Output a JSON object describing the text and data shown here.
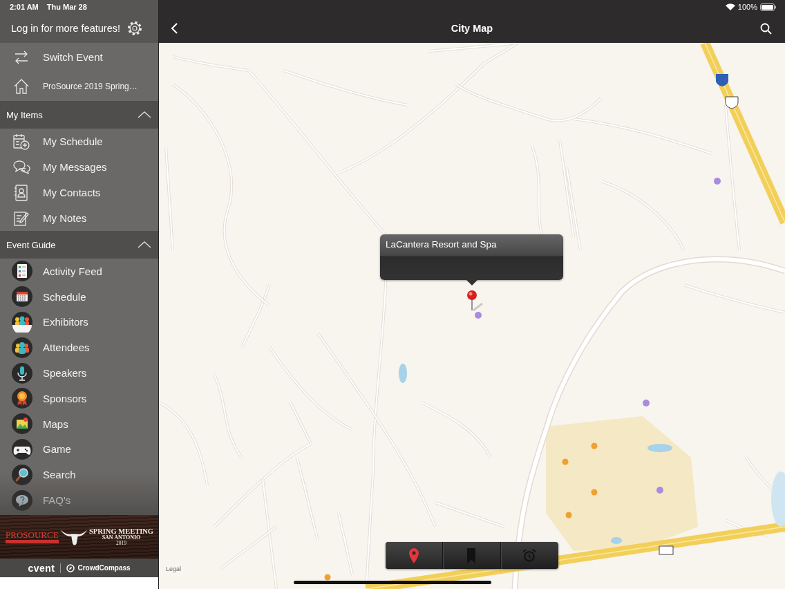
{
  "status_bar": {
    "time": "2:01 AM",
    "date": "Thu Mar 28",
    "battery": "100%"
  },
  "sidebar": {
    "login_prompt": "Log in for more features!",
    "top_items": [
      {
        "kind": "switch",
        "label": "Switch Event"
      },
      {
        "kind": "home",
        "label": "ProSource 2019 Spring…"
      }
    ],
    "sections": [
      {
        "title": "My Items",
        "expanded": true,
        "items": [
          {
            "kind": "schedule",
            "label": "My Schedule"
          },
          {
            "kind": "messages",
            "label": "My Messages"
          },
          {
            "kind": "contacts",
            "label": "My Contacts"
          },
          {
            "kind": "notes",
            "label": "My Notes"
          }
        ]
      },
      {
        "title": "Event Guide",
        "expanded": true,
        "items": [
          {
            "kind": "feed",
            "label": "Activity Feed"
          },
          {
            "kind": "calendar",
            "label": "Schedule"
          },
          {
            "kind": "exhibitors",
            "label": "Exhibitors"
          },
          {
            "kind": "attendees",
            "label": "Attendees"
          },
          {
            "kind": "speakers",
            "label": "Speakers"
          },
          {
            "kind": "sponsors",
            "label": "Sponsors"
          },
          {
            "kind": "maps",
            "label": "Maps"
          },
          {
            "kind": "game",
            "label": "Game"
          },
          {
            "kind": "search",
            "label": "Search"
          },
          {
            "kind": "faq",
            "label": "FAQ's"
          }
        ]
      }
    ],
    "banner": {
      "brand": "PROSOURCE",
      "event": "SPRING MEETING",
      "city": "SAN ANTONIO",
      "year": "2019"
    },
    "footer": {
      "vendor": "cvent",
      "product": "CrowdCompass"
    }
  },
  "nav_bar": {
    "title": "City Map"
  },
  "map": {
    "callout": {
      "title": "LaCantera Resort and Spa"
    },
    "legal": "Legal",
    "toolbar": [
      {
        "kind": "pin",
        "selected": true
      },
      {
        "kind": "bookmark",
        "selected": false
      },
      {
        "kind": "alarm",
        "selected": false
      }
    ]
  }
}
